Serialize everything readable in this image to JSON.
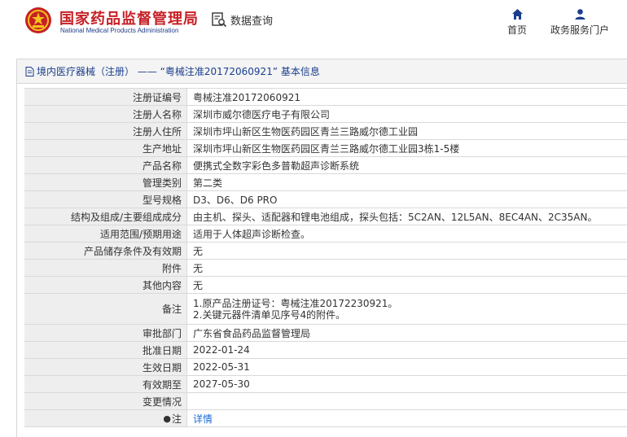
{
  "header": {
    "org_name_cn": "国家药品监督管理局",
    "org_name_en": "National Medical Products Administration",
    "search_tool_label": "数据查询",
    "nav": {
      "home_label": "首页",
      "gov_services_label": "政务服务门户"
    }
  },
  "panel": {
    "title": "境内医疗器械（注册） ——  “粤械注准20172060921”  基本信息"
  },
  "record": {
    "rows": [
      {
        "key": "注册证编号",
        "value": "粤械注准20172060921"
      },
      {
        "key": "注册人名称",
        "value": "深圳市威尔德医疗电子有限公司"
      },
      {
        "key": "注册人住所",
        "value": "深圳市坪山新区生物医药园区青兰三路威尔德工业园"
      },
      {
        "key": "生产地址",
        "value": "深圳市坪山新区生物医药园区青兰三路威尔德工业园3栋1-5楼"
      },
      {
        "key": "产品名称",
        "value": "便携式全数字彩色多普勒超声诊断系统"
      },
      {
        "key": "管理类别",
        "value": "第二类"
      },
      {
        "key": "型号规格",
        "value": "D3、D6、D6 PRO"
      },
      {
        "key": "结构及组成/主要组成成分",
        "value": "由主机、探头、适配器和锂电池组成，探头包括：5C2AN、12L5AN、8EC4AN、2C35AN。"
      },
      {
        "key": "适用范围/预期用途",
        "value": "适用于人体超声诊断检查。"
      },
      {
        "key": "产品储存条件及有效期",
        "value": "无"
      },
      {
        "key": "附件",
        "value": "无"
      },
      {
        "key": "其他内容",
        "value": "无"
      }
    ],
    "remarks_key": "备注",
    "remarks_line1": "1.原产品注册证号：粤械注准20172230921。",
    "remarks_line2": "2.关键元器件清单见序号4的附件。",
    "rows2": [
      {
        "key": "审批部门",
        "value": "广东省食品药品监督管理局"
      },
      {
        "key": "批准日期",
        "value": "2022-01-24"
      },
      {
        "key": "生效日期",
        "value": "2022-05-31"
      },
      {
        "key": "有效期至",
        "value": "2027-05-30"
      },
      {
        "key": "变更情况",
        "value": ""
      }
    ],
    "note_key": "注",
    "note_link": "详情"
  }
}
